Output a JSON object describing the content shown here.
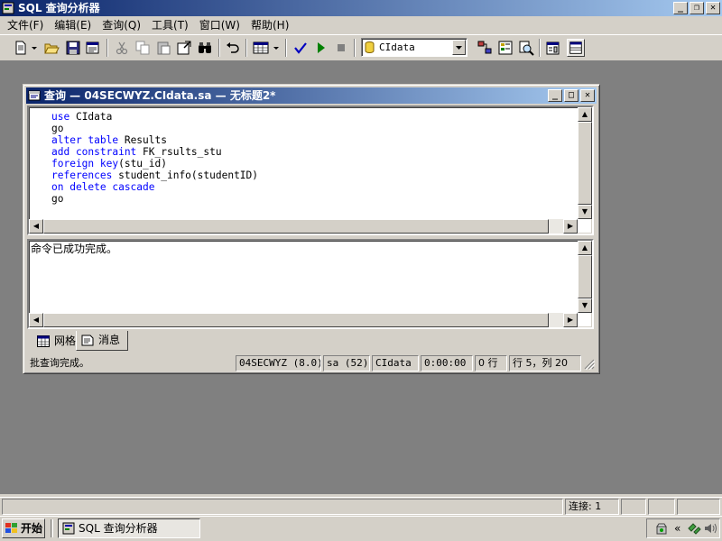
{
  "app": {
    "title": "SQL 查询分析器"
  },
  "menu": [
    "文件(F)",
    "编辑(E)",
    "查询(Q)",
    "工具(T)",
    "窗口(W)",
    "帮助(H)"
  ],
  "toolbar": {
    "database": "CIdata"
  },
  "query_window": {
    "title": "查询 — 04SECWYZ.CIdata.sa — 无标题2*",
    "code_lines": [
      [
        {
          "t": "use ",
          "k": true
        },
        {
          "t": "CIdata",
          "k": false
        }
      ],
      [
        {
          "t": "go",
          "k": false
        }
      ],
      [
        {
          "t": "alter table ",
          "k": true
        },
        {
          "t": "Results",
          "k": false
        }
      ],
      [
        {
          "t": "add constraint ",
          "k": true
        },
        {
          "t": "FK_rsults_stu",
          "k": false
        }
      ],
      [
        {
          "t": "foreign key",
          "k": true
        },
        {
          "t": "(stu_id)",
          "k": false
        }
      ],
      [
        {
          "t": "references ",
          "k": true
        },
        {
          "t": "student_info(studentID)",
          "k": false
        }
      ],
      [
        {
          "t": "on delete cascade",
          "k": true
        }
      ],
      [
        {
          "t": "go",
          "k": false
        }
      ]
    ],
    "message": "命令已成功完成。",
    "tabs": {
      "grid": "网格",
      "messages": "消息"
    },
    "status": {
      "text": "批查询完成。",
      "server": "04SECWYZ (8.0)",
      "user": "sa (52)",
      "db": "CIdata",
      "time": "0:00:00",
      "rows": "0 行",
      "position": "行 5，列 20"
    }
  },
  "main_status": {
    "connections": "连接: 1"
  },
  "taskbar": {
    "start": "开始",
    "app": "SQL 查询分析器"
  },
  "colors": {
    "keyword": "#0000ff",
    "titlebar": "#0a246a",
    "workspace": "#808080"
  }
}
